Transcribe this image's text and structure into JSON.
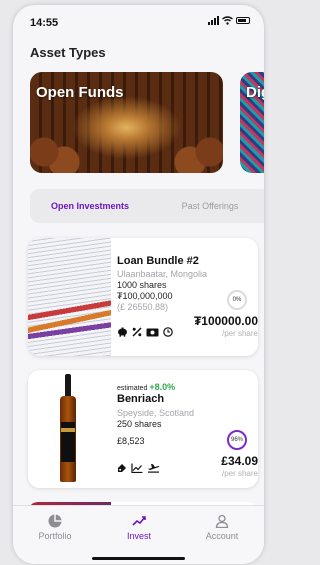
{
  "status_bar": {
    "time": "14:55"
  },
  "page": {
    "heading": "Asset Types"
  },
  "asset_types": [
    {
      "title": "Open Funds"
    },
    {
      "title": "Dig"
    }
  ],
  "tabs": [
    {
      "label": "Open Investments",
      "active": true
    },
    {
      "label": "Past Offerings",
      "active": false
    }
  ],
  "investments": [
    {
      "title": "Loan Bundle #2",
      "location": "Ulaanbaatar, Mongolia",
      "shares": "1000 shares",
      "amount": "₮100,000,000",
      "amount_converted": "(£ 26550.88)",
      "progress_label": "0%",
      "progress": 0,
      "price": "₮100000.00",
      "price_unit": "/per share",
      "icons": [
        "piggy-bank-icon",
        "percent-icon",
        "cash-icon",
        "clock-icon"
      ]
    },
    {
      "estimate_label": "estimated",
      "estimate_value": "+8.0%",
      "title": "Benriach",
      "location": "Speyside, Scotland",
      "shares": "250 shares",
      "amount": "£8,523",
      "progress_label": "96%",
      "progress": 96,
      "price": "£34.09",
      "price_unit": "/per share",
      "icons": [
        "tag-icon",
        "chart-icon",
        "plane-icon"
      ]
    }
  ],
  "nav": [
    {
      "label": "Portfolio",
      "icon": "pie-chart-icon",
      "active": false
    },
    {
      "label": "Invest",
      "icon": "trend-icon",
      "active": true
    },
    {
      "label": "Account",
      "icon": "user-icon",
      "active": false
    }
  ],
  "colors": {
    "accent": "#6d16c4",
    "positive": "#2fa84b",
    "muted": "#a4a4aa"
  }
}
